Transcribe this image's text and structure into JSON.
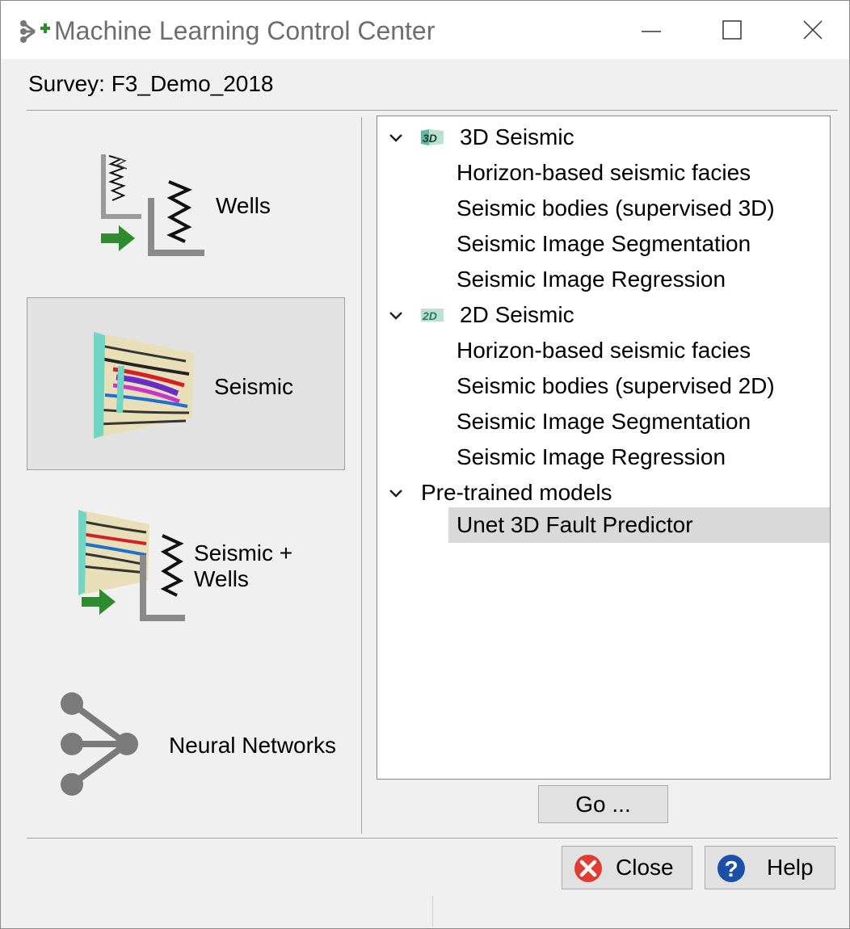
{
  "window": {
    "title": "Machine Learning Control Center",
    "minimize_icon": "minimize-icon",
    "maximize_icon": "maximize-icon",
    "close_icon": "close-icon"
  },
  "survey_label": "Survey: F3_Demo_2018",
  "categories": [
    {
      "label": "Wells",
      "icon": "wells-icon",
      "selected": false
    },
    {
      "label": "Seismic",
      "icon": "seismic-icon",
      "selected": true
    },
    {
      "label_line1": "Seismic +",
      "label_line2": "Wells",
      "icon": "seismic-wells-icon",
      "selected": false
    },
    {
      "label": "Neural Networks",
      "icon": "neural-network-icon",
      "selected": false
    }
  ],
  "tree": {
    "groups": [
      {
        "label": "3D Seismic",
        "icon": "3d-icon",
        "icon_text": "3D",
        "expanded": true,
        "items": [
          "Horizon-based seismic facies",
          "Seismic bodies (supervised 3D)",
          "Seismic Image Segmentation",
          "Seismic Image Regression"
        ]
      },
      {
        "label": "2D Seismic",
        "icon": "2d-icon",
        "icon_text": "2D",
        "expanded": true,
        "items": [
          "Horizon-based seismic facies",
          "Seismic bodies (supervised 2D)",
          "Seismic Image Segmentation",
          "Seismic Image Regression"
        ]
      },
      {
        "label": "Pre-trained models",
        "expanded": true,
        "items": [
          "Unet 3D Fault Predictor"
        ],
        "selected_item": "Unet 3D Fault Predictor"
      }
    ]
  },
  "buttons": {
    "go": "Go ...",
    "close": "Close",
    "help": "Help"
  },
  "colors": {
    "selected_row": "#d9d9d9",
    "close_icon_red": "#e03c31",
    "help_icon_blue": "#1b4fa8",
    "arrow_green": "#2e8b2e"
  }
}
